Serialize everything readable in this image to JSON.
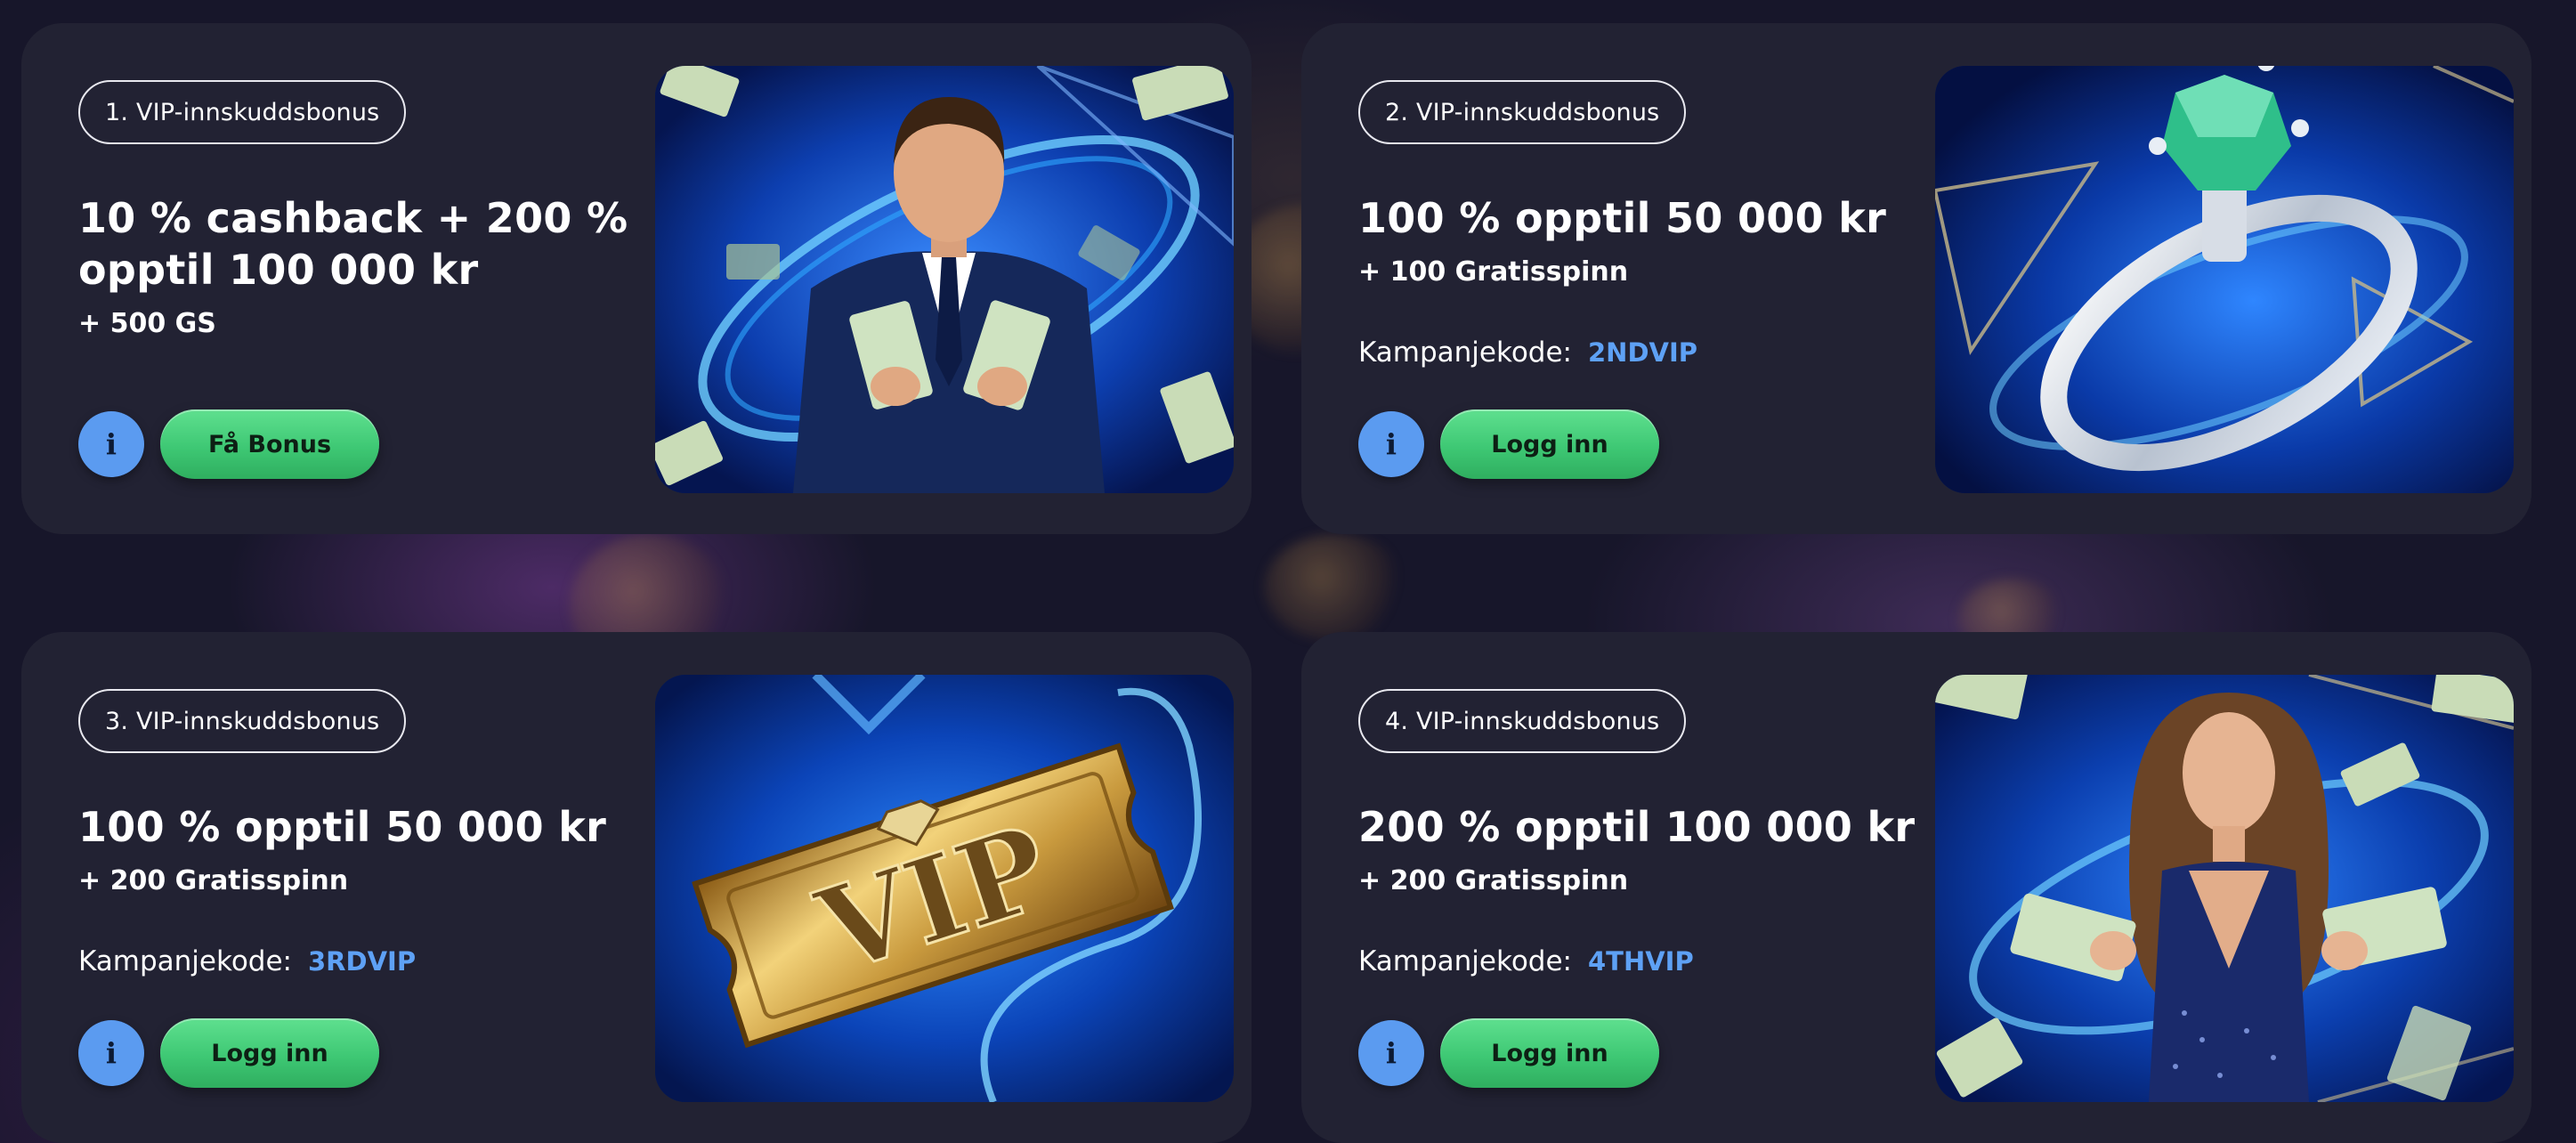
{
  "cards": [
    {
      "badge": "1. VIP-innskuddsbonus",
      "headline_line1": "10 % cashback + 200 %",
      "headline_line2": "opptil 100 000 kr",
      "subline": "+ 500 GS",
      "promo_label": "",
      "promo_code": "",
      "info_label": "i",
      "cta_label": "Få Bonus",
      "image": "man-in-suit-holding-dollar-bills"
    },
    {
      "badge": "2. VIP-innskuddsbonus",
      "headline_line1": "100 % opptil 50 000 kr",
      "headline_line2": "",
      "subline": "+ 100 Gratisspinn",
      "promo_label": "Kampanjekode:",
      "promo_code": "2NDVIP",
      "info_label": "i",
      "cta_label": "Logg inn",
      "image": "emerald-diamond-ring"
    },
    {
      "badge": "3. VIP-innskuddsbonus",
      "headline_line1": "100 % opptil 50 000 kr",
      "headline_line2": "",
      "subline": "+ 200 Gratisspinn",
      "promo_label": "Kampanjekode:",
      "promo_code": "3RDVIP",
      "info_label": "i",
      "cta_label": "Logg inn",
      "image": "golden-vip-ticket"
    },
    {
      "badge": "4. VIP-innskuddsbonus",
      "headline_line1": "200 % opptil 100 000 kr",
      "headline_line2": "",
      "subline": "+ 200 Gratisspinn",
      "promo_label": "Kampanjekode:",
      "promo_code": "4THVIP",
      "info_label": "i",
      "cta_label": "Logg inn",
      "image": "woman-in-sequin-dress-holding-dollar-bills"
    }
  ],
  "art_text": {
    "vip_ticket": "VIP"
  },
  "colors": {
    "page_background": "#17162a",
    "card_background": "#222233",
    "cta_green": "#3ec874",
    "info_blue": "#5b9bf0",
    "promo_code_blue": "#5ea1f5",
    "badge_border": "#e8e8ef"
  }
}
